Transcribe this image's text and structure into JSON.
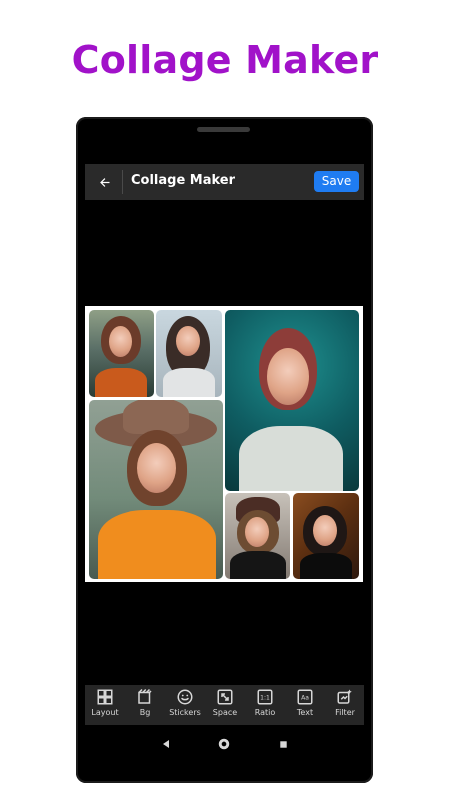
{
  "promo": {
    "title": "Collage Maker"
  },
  "header": {
    "title": "Collage Maker",
    "save_label": "Save"
  },
  "toolbar": {
    "items": [
      {
        "label": "Layout",
        "icon": "layout-icon"
      },
      {
        "label": "Bg",
        "icon": "background-icon"
      },
      {
        "label": "Stickers",
        "icon": "sticker-icon"
      },
      {
        "label": "Space",
        "icon": "space-icon"
      },
      {
        "label": "Ratio",
        "icon": "ratio-icon"
      },
      {
        "label": "Text",
        "icon": "text-icon"
      },
      {
        "label": "Filter",
        "icon": "filter-icon"
      }
    ]
  },
  "ratio_icon_text": "1:1",
  "text_icon_text": "Aa",
  "navigation": {
    "items": [
      "back",
      "home",
      "recent"
    ]
  },
  "colors": {
    "promo_title": "#a112c9",
    "save_button": "#1f7cf2",
    "toolbar_bg": "#262626",
    "header_bg": "#2a2a2a"
  }
}
